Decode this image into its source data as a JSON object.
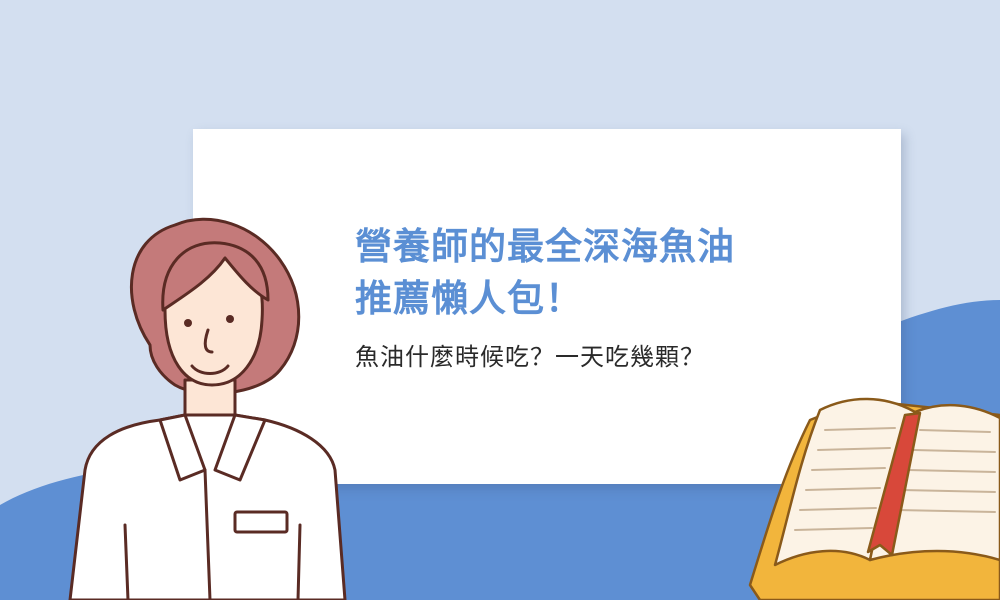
{
  "banner": {
    "title_line1": "營養師的最全深海魚油",
    "title_line2": "推薦懶人包！",
    "subtitle": "魚油什麼時候吃？一天吃幾顆？"
  },
  "colors": {
    "background": "#d3dff0",
    "blob": "#5e8fd3",
    "card": "#ffffff",
    "title": "#5b8fd4",
    "subtitle": "#2a2a2a",
    "hair": "#c47a7a",
    "book_cover": "#f2b53c",
    "bookmark": "#d8483a"
  },
  "illustrations": [
    "nutritionist-character",
    "open-book",
    "blue-wave-shape"
  ]
}
